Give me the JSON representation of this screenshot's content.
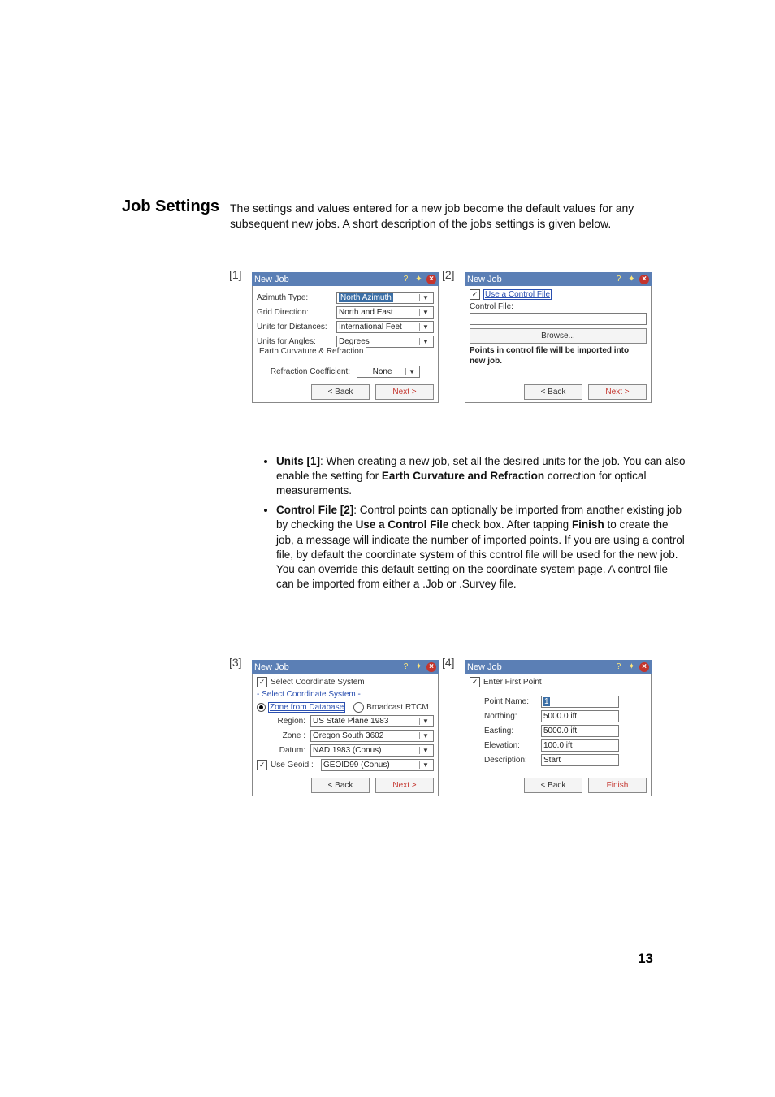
{
  "heading": "Job Settings",
  "intro": "The settings and values entered for a new job become the default values for any subsequent new jobs. A short description of the jobs settings is given below.",
  "tags": {
    "s1": "[1]",
    "s2": "[2]",
    "s3": "[3]",
    "s4": "[4]"
  },
  "common": {
    "title": "New Job",
    "back": "< Back",
    "next": "Next  >",
    "finish": "Finish",
    "browse": "Browse..."
  },
  "s1": {
    "rows": {
      "azType": "Azimuth Type:",
      "grid": "Grid Direction:",
      "dist": "Units for Distances:",
      "ang": "Units for Angles:"
    },
    "vals": {
      "azType": "North Azimuth",
      "grid": "North and East",
      "dist": "International Feet",
      "ang": "Degrees"
    },
    "group": "Earth Curvature & Refraction",
    "refr_lbl": "Refraction Coefficient:",
    "refr_val": "None"
  },
  "s2": {
    "useCtrl": "Use a Control File",
    "ctrlFile": "Control File:",
    "note": "Points in control file will be imported into new job."
  },
  "s3": {
    "selCS": "Select Coordinate System",
    "subhdr": "- Select Coordinate System -",
    "optDB": "Zone from Database",
    "optRTCM": "Broadcast RTCM",
    "rows": {
      "region": "Region:",
      "zone": "Zone :",
      "datum": "Datum:"
    },
    "vals": {
      "region": "US State Plane 1983",
      "zone": "Oregon South 3602",
      "datum": "NAD 1983 (Conus)",
      "geoid": "GEOID99 (Conus)"
    },
    "useGeoid": "Use Geoid :"
  },
  "s4": {
    "enterFP": "Enter First Point",
    "rows": {
      "pn": "Point Name:",
      "north": "Northing:",
      "east": "Easting:",
      "elev": "Elevation:",
      "desc": "Description:"
    },
    "vals": {
      "pn": "1",
      "north": "5000.0 ift",
      "east": "5000.0 ift",
      "elev": "100.0 ift",
      "desc": "Start"
    }
  },
  "bullets": {
    "u_head": "Units [1]",
    "u_body_a": ": When creating a new job, set all the desired units for the job. You can also enable the setting for ",
    "u_bold": "Earth Curvature and Refraction",
    "u_body_b": " correction for optical measurements.",
    "c_head": "Control File [2]",
    "c_body_a": ": Control points can optionally be imported from another existing job by checking the ",
    "c_bold1": "Use a Control File",
    "c_body_b": " check box. After tapping ",
    "c_bold2": "Finish",
    "c_body_c": " to create the job, a message will indicate the number of imported points. If you are using a control file, by default the coordinate system of this control file will be used for the new job. You can override this default setting on the coordinate system page. A control file can be imported from either a .Job or .Survey file."
  },
  "pagenum": "13"
}
